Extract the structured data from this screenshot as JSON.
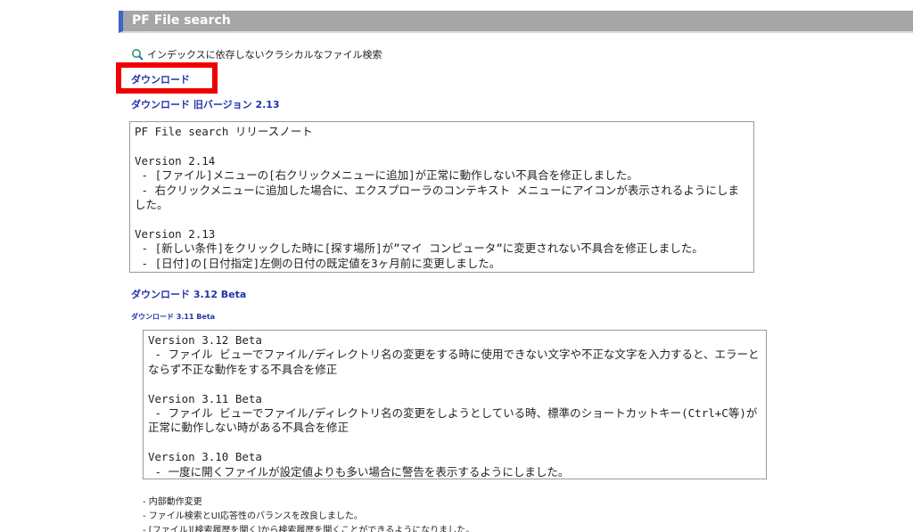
{
  "header": {
    "title": "PF File search"
  },
  "tagline": {
    "icon": "search-icon",
    "text": "インデックスに依存しないクラシカルなファイル検索"
  },
  "links": {
    "download": "ダウンロード",
    "download_old": "ダウンロード 旧バージョン 2.13",
    "download_beta_312": "ダウンロード 3.12 Beta",
    "download_beta_311": "ダウンロード 3.11 Beta"
  },
  "release_notes": {
    "text": "PF File search リリースノート\n\nVersion 2.14\n - [ファイル]メニューの[右クリックメニューに追加]が正常に動作しない不具合を修正しました。\n - 右クリックメニューに追加した場合に、エクスプローラのコンテキスト メニューにアイコンが表示されるようにしました。\n\nVersion 2.13\n - [新しい条件]をクリックした時に[探す場所]が”マイ コンピュータ”に変更されない不具合を修正しました。\n - [日付]の[日付指定]左側の日付の既定値を3ヶ月前に変更しました。"
  },
  "beta_notes": {
    "text": "Version 3.12 Beta\n - ファイル ビューでファイル/ディレクトリ名の変更をする時に使用できない文字や不正な文字を入力すると、エラーとならず不正な動作をする不具合を修正\n\nVersion 3.11 Beta\n - ファイル ビューでファイル/ディレクトリ名の変更をしようとしている時、標準のショートカットキー(Ctrl+C等)が正常に動作しない時がある不具合を修正\n\nVersion 3.10 Beta\n - 一度に開くファイルが設定値よりも多い場合に警告を表示するようにしました。"
  },
  "bottom_notes": {
    "line1": "- 内部動作変更",
    "line2": "- ファイル検索とUI応答性のバランスを改良しました。",
    "line3": "- [ファイル][検索履歴を開く]から検索履歴を開くことができるようになりました。"
  },
  "colors": {
    "header_bg": "#a6a6a6",
    "header_accent": "#3a66c4",
    "link": "#2233aa",
    "highlight": "#ee0000"
  }
}
